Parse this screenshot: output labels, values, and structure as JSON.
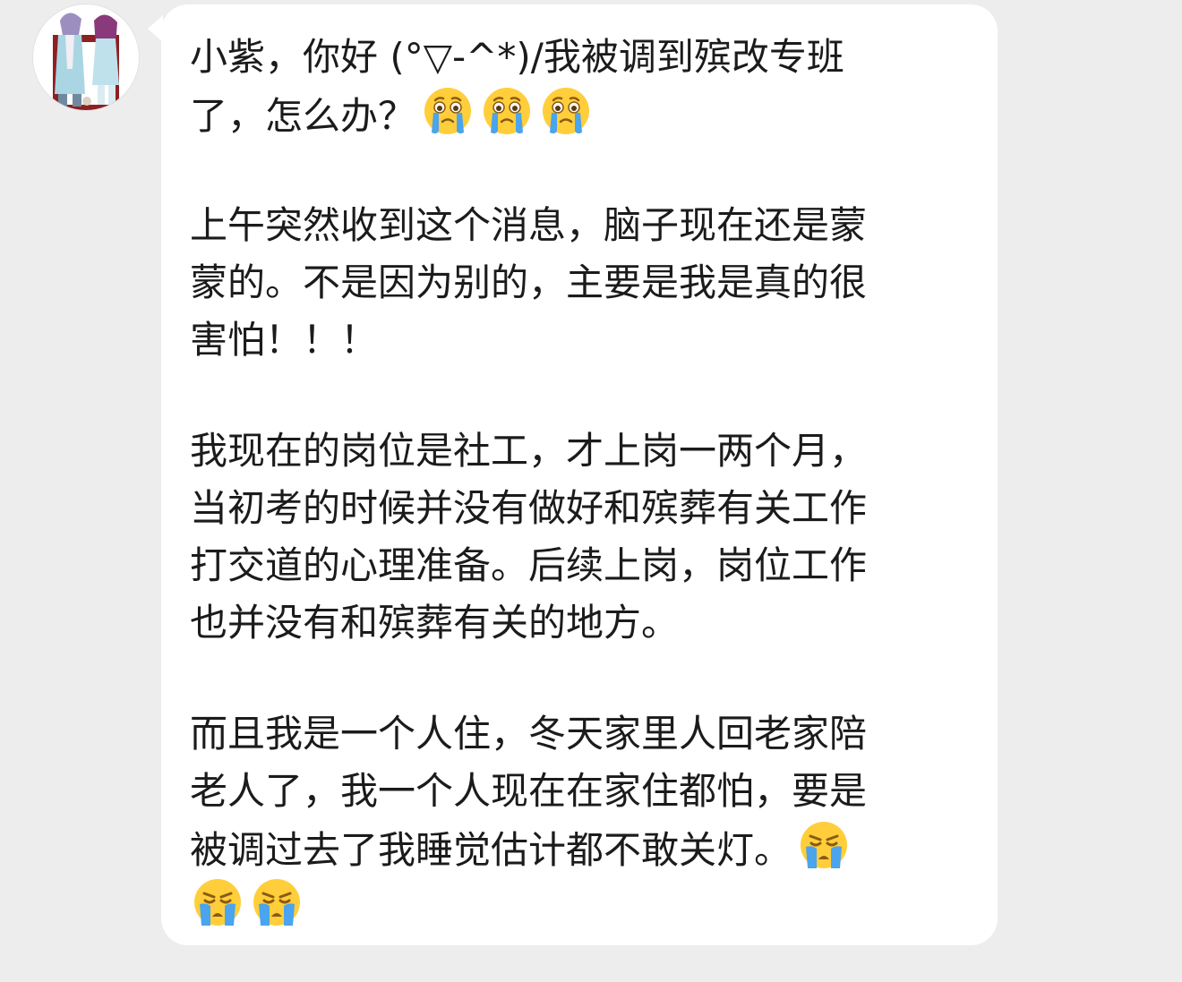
{
  "message": {
    "paragraph_1": {
      "line_1": "小紫，你好 (°▽-^*)/我被调到殡改专班",
      "line_2": "了，怎么办？"
    },
    "paragraph_2": {
      "line_1": "上午突然收到这个消息，脑子现在还是蒙",
      "line_2": "蒙的。不是因为别的，主要是我是真的很",
      "line_3": "害怕！！！"
    },
    "paragraph_3": {
      "line_1": "我现在的岗位是社工，才上岗一两个月，",
      "line_2": "当初考的时候并没有做好和殡葬有关工作",
      "line_3": "打交道的心理准备。后续上岗，岗位工作",
      "line_4": "也并没有和殡葬有关的地方。"
    },
    "paragraph_4": {
      "line_1": "而且我是一个人住，冬天家里人回老家陪",
      "line_2": "老人了，我一个人现在在家住都怕，要是",
      "line_3": "被调过去了我睡觉估计都不敢关灯。"
    },
    "emojis": {
      "tearful_face": "tearful-face-icon",
      "crying_face": "crying-face-icon"
    }
  },
  "colors": {
    "chat_background": "#ededed",
    "bubble_background": "#ffffff",
    "text": "#1b1b1b",
    "emoji_face": "#ffce3a",
    "tear": "#4aa4ee"
  }
}
